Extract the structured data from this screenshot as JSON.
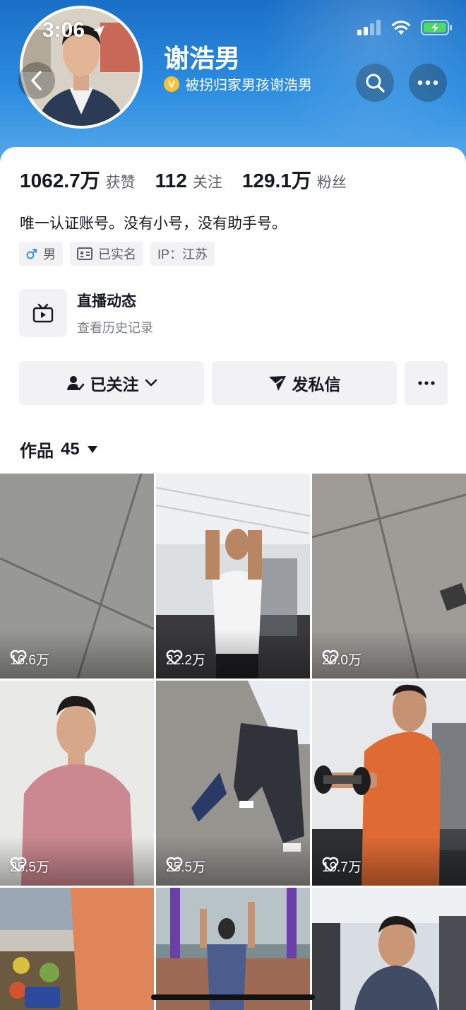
{
  "status_bar": {
    "time": "3:06"
  },
  "profile": {
    "name": "谢浩男",
    "verified_badge": "V",
    "verified_text": "被拐归家男孩谢浩男"
  },
  "stats": [
    {
      "value": "1062.7万",
      "label": "获赞"
    },
    {
      "value": "112",
      "label": "关注"
    },
    {
      "value": "129.1万",
      "label": "粉丝"
    }
  ],
  "bio": "唯一认证账号。没有小号，没有助手号。",
  "tags": {
    "gender": "男",
    "realname": "已实名",
    "ip": "IP：江苏"
  },
  "live": {
    "title": "直播动态",
    "subtitle": "查看历史记录"
  },
  "actions": {
    "follow": "已关注",
    "message": "发私信"
  },
  "works": {
    "label": "作品",
    "count": "45"
  },
  "videos": [
    {
      "likes": "16.6万"
    },
    {
      "likes": "22.2万"
    },
    {
      "likes": "20.0万"
    },
    {
      "likes": "25.5万"
    },
    {
      "likes": "25.5万"
    },
    {
      "likes": "19.7万"
    },
    {
      "likes": ""
    },
    {
      "likes": ""
    },
    {
      "likes": ""
    }
  ],
  "colors": {
    "header_blue": "#2d8de0",
    "verify_gold": "#f5c33b",
    "button_bg": "#f2f2f4"
  },
  "icons": [
    "back-arrow-icon",
    "search-icon",
    "more-icon",
    "male-icon",
    "id-card-icon",
    "tv-icon",
    "user-check-icon",
    "chevron-down-icon",
    "send-icon",
    "heart-icon",
    "caret-down-icon"
  ]
}
